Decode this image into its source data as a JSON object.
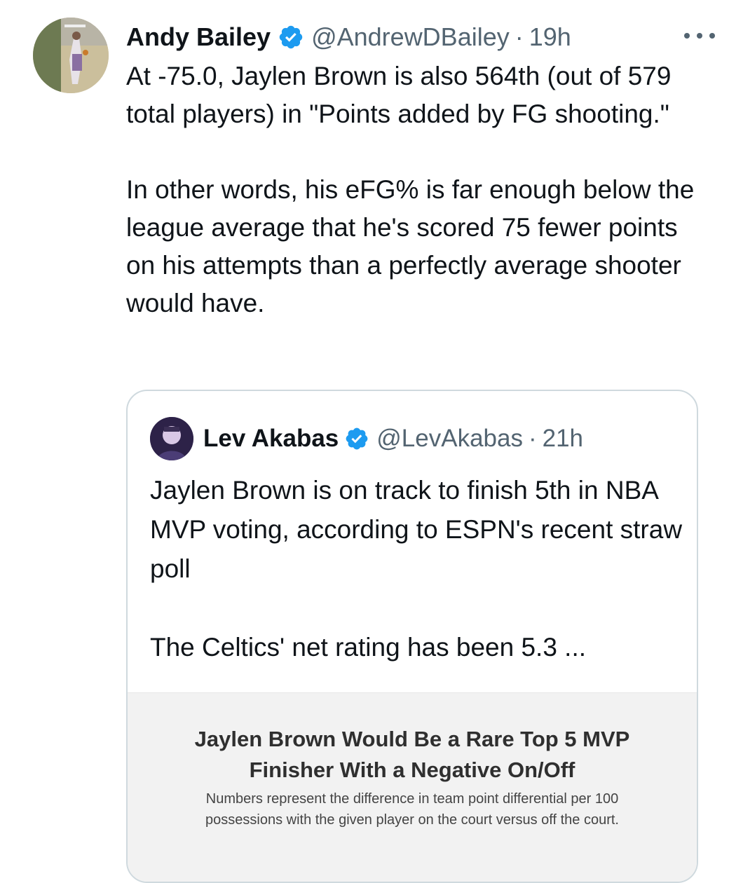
{
  "tweet": {
    "author_name": "Andy Bailey",
    "handle": "@AndrewDBailey",
    "separator": "·",
    "time": "19h",
    "paragraph1": "At -75.0, Jaylen Brown is also 564th (out of 579 total players) in \"Points added by FG shooting.\"",
    "paragraph2": "In other words, his eFG% is far enough below the league average that he's scored 75 fewer points on his attempts than a perfectly average shooter would have."
  },
  "quoted": {
    "author_name": "Lev Akabas",
    "handle": "@LevAkabas",
    "separator": "·",
    "time": "21h",
    "paragraph1": "Jaylen Brown is on track to finish 5th in NBA MVP voting, according to ESPN's recent straw poll",
    "paragraph2": "The Celtics' net rating has been 5.3 ...",
    "card": {
      "title_line1": "Jaylen Brown Would Be a Rare Top 5 MVP",
      "title_line2": "Finisher With a Negative On/Off",
      "subtitle_line1": "Numbers represent the difference in team point differential per 100",
      "subtitle_line2": "possessions with the given player on the court versus off the court."
    }
  },
  "colors": {
    "verified": "#1d9bf0",
    "secondary_text": "#536471",
    "border": "#cfd9de"
  },
  "icons": {
    "verified": "verified-badge-icon",
    "more": "more-options-icon"
  }
}
